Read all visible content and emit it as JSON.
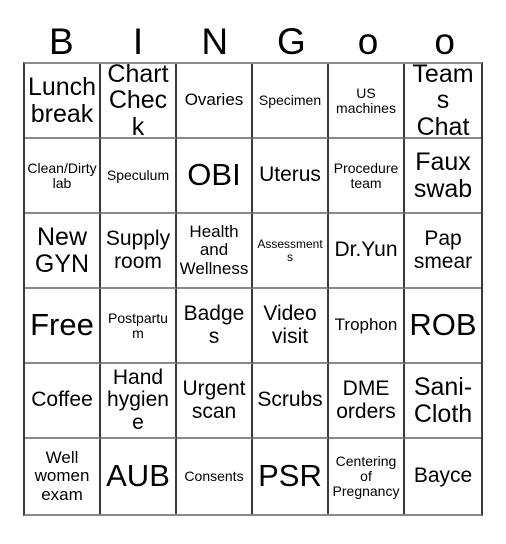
{
  "card": {
    "headers": [
      "B",
      "I",
      "N",
      "G",
      "o",
      "o"
    ],
    "rows": [
      [
        {
          "text": "Lunch break",
          "size": "lg"
        },
        {
          "text": "Chart Check",
          "size": "lg"
        },
        {
          "text": "Ovaries",
          "size": "sm"
        },
        {
          "text": "Specimen",
          "size": "xs"
        },
        {
          "text": "US machines",
          "size": "xs"
        },
        {
          "text": "Teams Chat",
          "size": "lg"
        }
      ],
      [
        {
          "text": "Clean/Dirty lab",
          "size": "xs"
        },
        {
          "text": "Speculum",
          "size": "xs"
        },
        {
          "text": "OBI",
          "size": "xl"
        },
        {
          "text": "Uterus",
          "size": "md"
        },
        {
          "text": "Procedure team",
          "size": "xs"
        },
        {
          "text": "Faux swab",
          "size": "lg"
        }
      ],
      [
        {
          "text": "New GYN",
          "size": "lg"
        },
        {
          "text": "Supply room",
          "size": "md"
        },
        {
          "text": "Health and Wellness",
          "size": "sm"
        },
        {
          "text": "Assessments",
          "size": "xxs"
        },
        {
          "text": "Dr.Yun",
          "size": "md"
        },
        {
          "text": "Pap smear",
          "size": "md"
        }
      ],
      [
        {
          "text": "Free",
          "size": "xl"
        },
        {
          "text": "Postpartum",
          "size": "xs"
        },
        {
          "text": "Badges",
          "size": "md"
        },
        {
          "text": "Video visit",
          "size": "md"
        },
        {
          "text": "Trophon",
          "size": "sm"
        },
        {
          "text": "ROB",
          "size": "xl"
        }
      ],
      [
        {
          "text": "Coffee",
          "size": "md"
        },
        {
          "text": "Hand hygiene",
          "size": "md"
        },
        {
          "text": "Urgent scan",
          "size": "md"
        },
        {
          "text": "Scrubs",
          "size": "md"
        },
        {
          "text": "DME orders",
          "size": "md"
        },
        {
          "text": "Sani-Cloth",
          "size": "lg"
        }
      ],
      [
        {
          "text": "Well women exam",
          "size": "sm"
        },
        {
          "text": "AUB",
          "size": "xl"
        },
        {
          "text": "Consents",
          "size": "xs"
        },
        {
          "text": "PSR",
          "size": "xl"
        },
        {
          "text": "Centering of Pregnancy",
          "size": "xs"
        },
        {
          "text": "Bayce",
          "size": "md"
        }
      ]
    ]
  },
  "colors": {
    "background": "#ffffff",
    "text": "#000000",
    "border_vertical": "#3a3a3a",
    "border_horizontal": "#8a8a8a"
  }
}
